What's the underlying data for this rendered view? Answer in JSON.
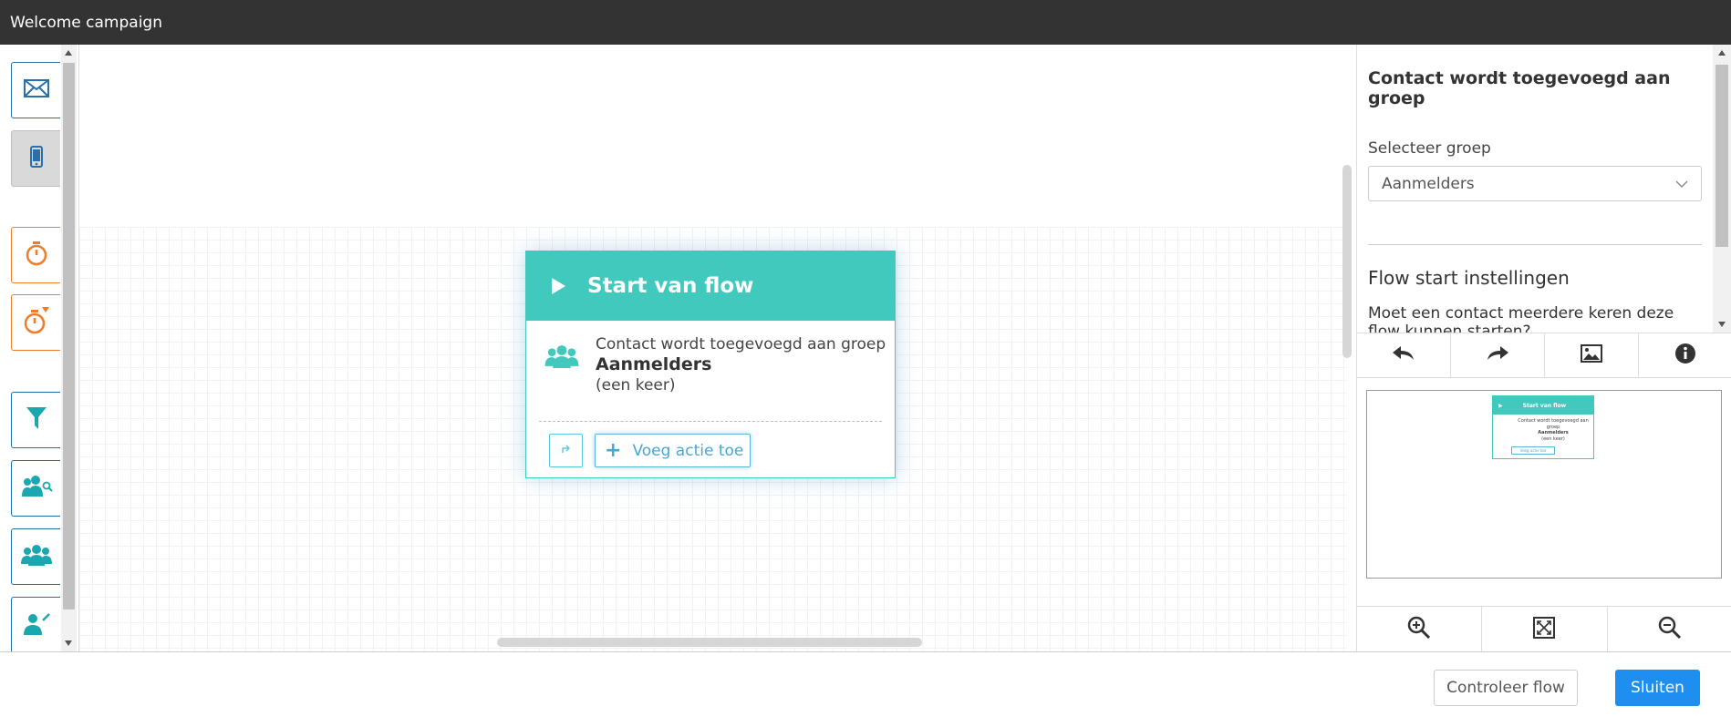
{
  "window": {
    "title": "Welcome campaign"
  },
  "node": {
    "title": "Start van flow",
    "trigger_text": "Contact wordt toegevoegd aan groep",
    "group_name": "Aanmelders",
    "frequency": "(een keer)",
    "add_action_label": "Voeg actie toe"
  },
  "panel": {
    "title": "Contact wordt toegevoegd aan groep",
    "select_label": "Selecteer groep",
    "selected_group": "Aanmelders",
    "section_title": "Flow start instellingen",
    "question": "Moet een contact meerdere keren deze flow kunnen starten?"
  },
  "minimap": {
    "title": "Start van flow",
    "trigger_text": "Contact wordt toegevoegd aan groep",
    "group_name": "Aanmelders",
    "frequency": "(een keer)",
    "add_action_label": "Voeg actie toe"
  },
  "footer": {
    "check_label": "Controleer flow",
    "close_label": "Sluiten"
  },
  "colors": {
    "accent": "#42c9be",
    "primary_button": "#1e8ff0",
    "palette_blue": "#2a6fa8",
    "palette_orange": "#f07c2a",
    "titlebar": "#333333"
  },
  "icons": {
    "palette": [
      "email-icon",
      "sms-icon",
      "timer-icon",
      "timer-condition-icon",
      "filter-icon",
      "search-group-icon",
      "group-icon",
      "contact-update-icon"
    ],
    "toolbar": [
      "undo-icon",
      "redo-icon",
      "image-icon",
      "info-icon"
    ],
    "zoom": [
      "zoom-in-icon",
      "fit-screen-icon",
      "zoom-out-icon"
    ]
  }
}
